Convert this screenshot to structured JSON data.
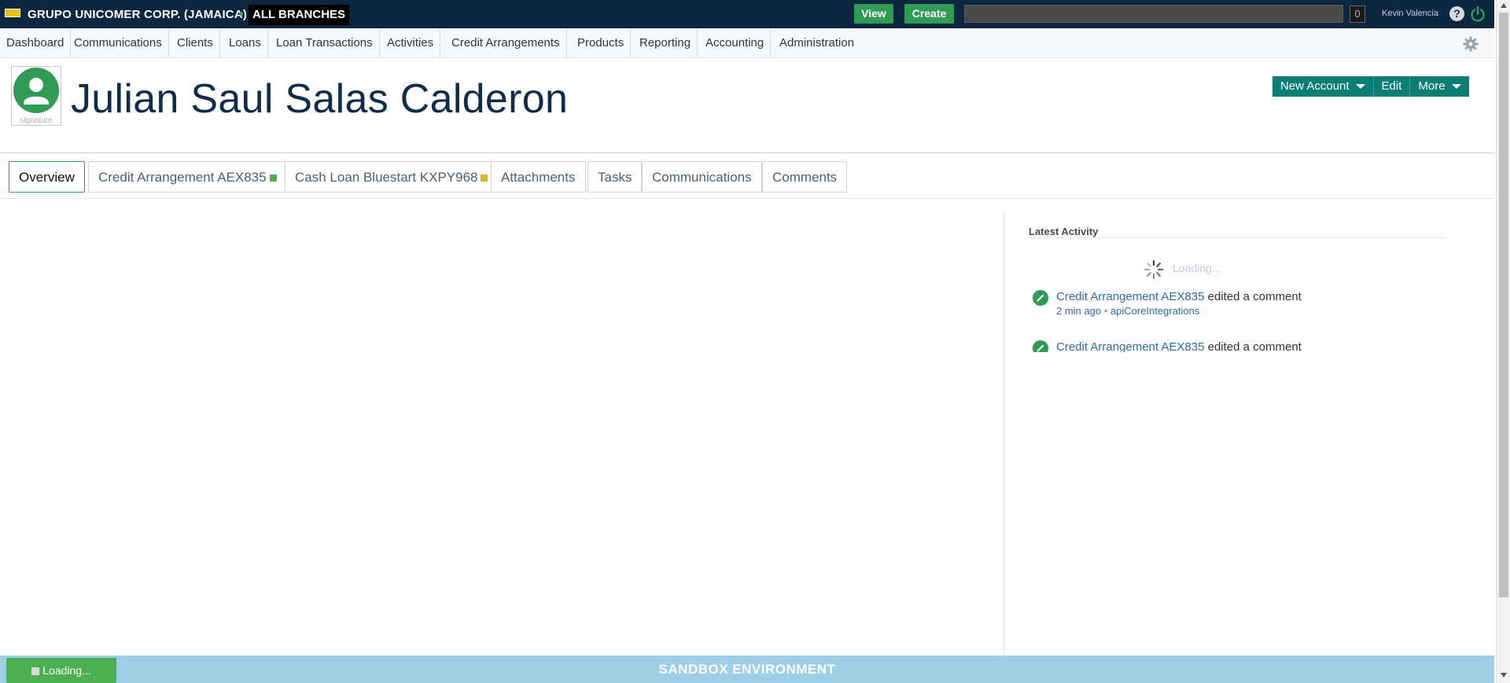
{
  "topbar": {
    "org": "GRUPO UNICOMER CORP. (JAMAICA)",
    "branch": "ALL BRANCHES",
    "view_label": "View",
    "create_label": "Create",
    "search_value": "",
    "counter": "0",
    "user": "Kevin Valencia",
    "help_glyph": "?",
    "icons": [
      "logo",
      "help-icon",
      "power-icon"
    ],
    "bg_color": "#0d2741",
    "accent_green": "#2f9b55"
  },
  "nav": {
    "items": [
      "Dashboard",
      "Communications",
      "Clients",
      "Loans",
      "Loan Transactions",
      "Activities",
      "Credit Arrangements",
      "Products",
      "Reporting",
      "Accounting",
      "Administration"
    ],
    "settings_icon": "gear-icon"
  },
  "header": {
    "avatar_caption": "signature",
    "client_name": "Julian Saul Salas Calderon",
    "actions": {
      "new_account": "New Account",
      "edit": "Edit",
      "more": "More"
    },
    "action_color": "#0a7d74"
  },
  "tabs": [
    {
      "label": "Overview",
      "active": true
    },
    {
      "label": "Credit Arrangement AEX835",
      "status_color": "#4caf50"
    },
    {
      "label": "Cash Loan Bluestart KXPY968",
      "status_color": "#e0b800"
    },
    {
      "label": "Attachments"
    },
    {
      "label": "Tasks"
    },
    {
      "label": "Communications"
    },
    {
      "label": "Comments"
    }
  ],
  "latest_activity": {
    "title": "Latest Activity",
    "loading": "Loading...",
    "items": [
      {
        "link": "Credit Arrangement AEX835",
        "action": " edited a comment",
        "time": "2 min ago",
        "sep": " • ",
        "user": "apiCoreIntegrations"
      },
      {
        "link": "Credit Arrangement AEX835",
        "action": " edited a comment"
      }
    ]
  },
  "footer": {
    "environment": "SANDBOX ENVIRONMENT",
    "loading": "Loading...",
    "bg_color": "#9dcfe6"
  }
}
